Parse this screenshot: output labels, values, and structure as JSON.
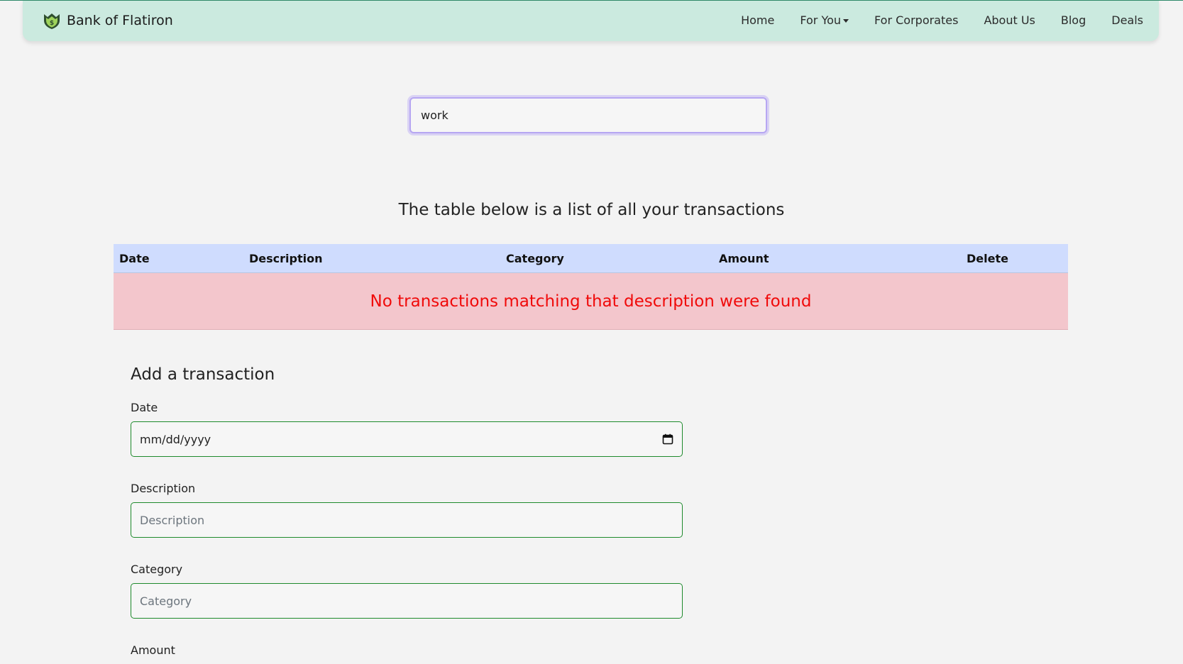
{
  "brand": {
    "name": "Bank of Flatiron",
    "icon": "shield-dollar-icon"
  },
  "nav": [
    {
      "label": "Home"
    },
    {
      "label": "For You",
      "dropdown": true
    },
    {
      "label": "For Corporates"
    },
    {
      "label": "About Us"
    },
    {
      "label": "Blog"
    },
    {
      "label": "Deals"
    }
  ],
  "search": {
    "value": "work"
  },
  "table": {
    "title": "The table below is a list of all your transactions",
    "headers": [
      "Date",
      "Description",
      "Category",
      "Amount",
      "Delete"
    ],
    "empty_message": "No transactions matching that description were found"
  },
  "form": {
    "title": "Add a transaction",
    "date_label": "Date",
    "date_placeholder": "mm/dd/yyyy",
    "description_label": "Description",
    "description_placeholder": "Description",
    "category_label": "Category",
    "category_placeholder": "Category",
    "amount_label": "Amount"
  },
  "colors": {
    "navbar_bg": "#cbeadf",
    "table_header_bg": "#cfdcfe",
    "empty_row_bg": "#f3c6cc",
    "error_text": "#f00a0a",
    "field_border": "#1e8a2c",
    "search_focus": "#b6a6f2"
  }
}
